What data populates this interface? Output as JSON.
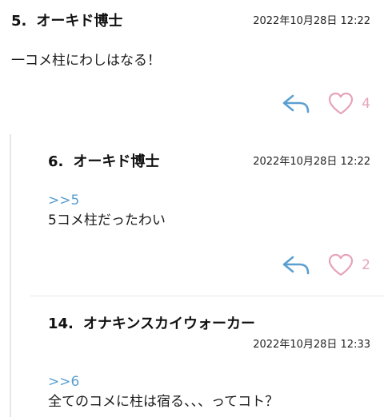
{
  "comments": [
    {
      "number": "5.",
      "name": "オーキド博士",
      "date": "2022年10月28日 12:22",
      "reply_to": "",
      "body": "一コメ柱にわしはなる！",
      "likes": "4"
    },
    {
      "number": "6.",
      "name": "オーキド博士",
      "date": "2022年10月28日 12:22",
      "reply_to": ">>5",
      "body": "5コメ柱だったわい",
      "likes": "2"
    },
    {
      "number": "14.",
      "name": "オナキンスカイウォーカー",
      "date": "2022年10月28日 12:33",
      "reply_to": ">>6",
      "body": "全てのコメに柱は宿る、、、ってコト？"
    }
  ],
  "icons": {
    "reply": "reply-arrow-icon",
    "like": "heart-icon"
  },
  "colors": {
    "reply_icon": "#5a9fd0",
    "heart_icon": "#e6a3b7",
    "reply_link": "#5a9fd0"
  }
}
